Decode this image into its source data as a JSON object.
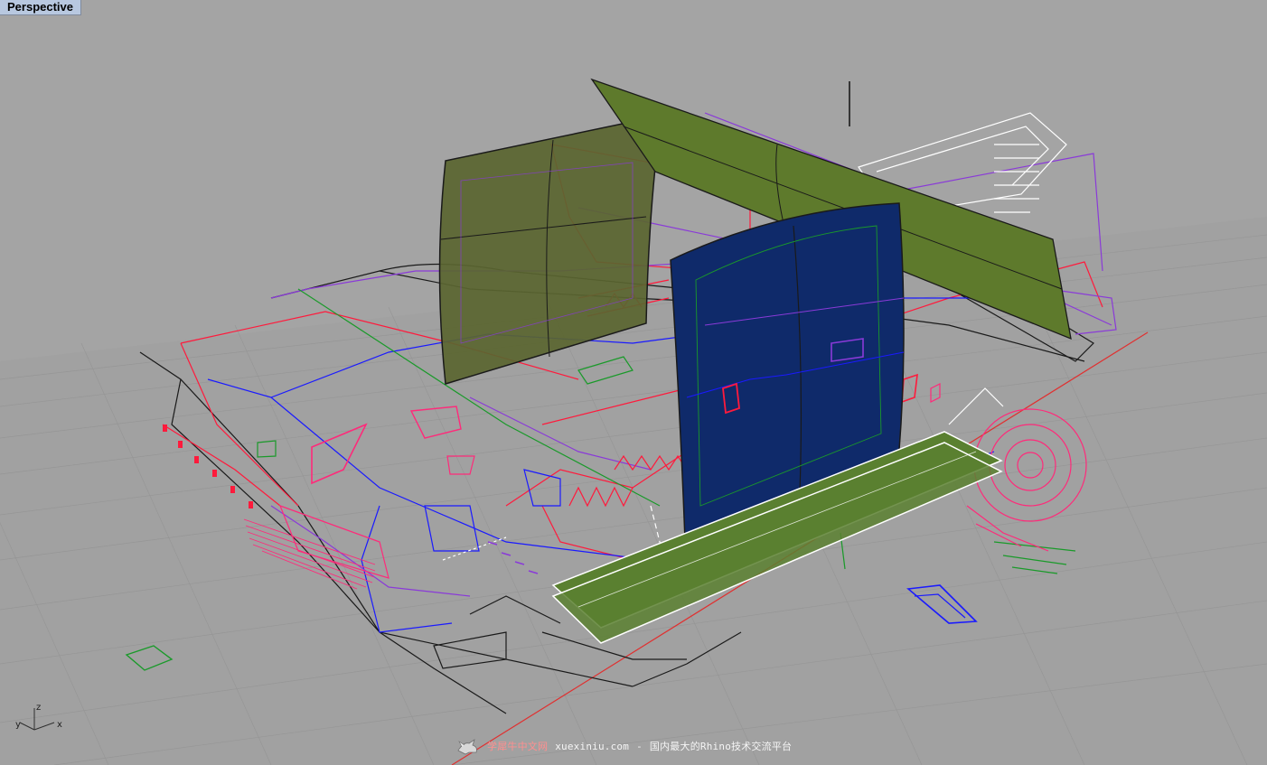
{
  "viewport": {
    "title": "Perspective"
  },
  "axis_gizmo": {
    "z_label": "z",
    "y_label": "y",
    "x_label": "x"
  },
  "watermark": {
    "brand": "学犀牛中文网",
    "url": "xuexiniu.com",
    "separator": "-",
    "slogan": "国内最大的Rhino技术交流平台"
  },
  "colors": {
    "background": "#a4a4a4",
    "grid": "#999999",
    "grid_major": "#8c8c8c",
    "panel_green": "#5e7a2c",
    "panel_green_dark": "#4a5a2a",
    "panel_blue": "#0f2a6a",
    "curve_red": "#ff1a3c",
    "curve_blue": "#1a1aff",
    "curve_purple": "#8a3ad8",
    "curve_black": "#1a1a1a",
    "curve_green": "#1a9a2a",
    "curve_white": "#ffffff",
    "curve_pink": "#ff2a7a"
  }
}
